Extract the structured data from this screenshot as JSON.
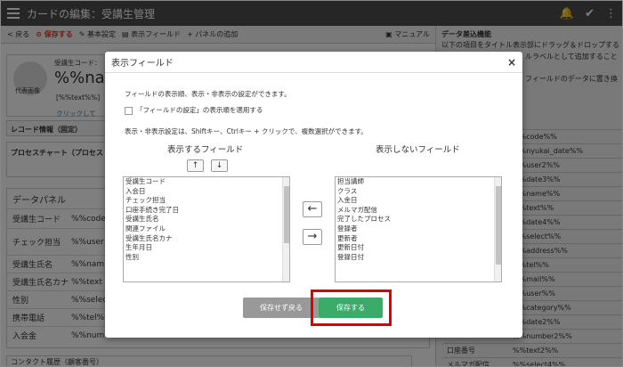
{
  "window": {
    "title": "カードの編集：受講生管理"
  },
  "toolbar": {
    "back": "< 戻る",
    "save": "保存する",
    "basic": "基本設定",
    "fields": "表示フィールド",
    "panel": "+ パネルの追加",
    "manual": "マニュアル"
  },
  "background": {
    "student_code_label": "受講生コード：",
    "name_value": "%%nam",
    "text_value": "[%%text%%]",
    "photo_label": "代表画像",
    "click_link": "クリックして",
    "record_info": "レコード情報（固定）",
    "process_chart": "プロセスチャート（プロセス",
    "data_panel": "データパネル",
    "rows": [
      {
        "label": "受講生コード",
        "value": "%%code"
      },
      {
        "label": "チェック担当",
        "value": "%%user"
      },
      {
        "label": "受講生氏名",
        "value": "%%nam"
      },
      {
        "label": "受講生氏名カナ",
        "value": "%%text"
      },
      {
        "label": "性別",
        "value": "%%select"
      },
      {
        "label": "携帯電話",
        "value": "%%tel%"
      },
      {
        "label": "入会金",
        "value": "%%num"
      }
    ],
    "history": "コンタクト履歴（顧客番号）"
  },
  "right_panel": {
    "title": "データ差込機能",
    "desc1": "以下の項目をタイトル表示部にドラッグ＆ドロップする",
    "desc2": "ルラベルとして追加すること",
    "desc3": "フィールドのデータに置き換",
    "rows": [
      {
        "k": "",
        "v": "%%code%%"
      },
      {
        "k": "",
        "v": "%%nyukai_date%%"
      },
      {
        "k": "",
        "v": "%%user2%%"
      },
      {
        "k": "",
        "v": "%%date3%%"
      },
      {
        "k": "",
        "v": "%%name%%"
      },
      {
        "k": "",
        "v": "%%text%%"
      },
      {
        "k": "",
        "v": "%%date4%%"
      },
      {
        "k": "",
        "v": "%%select%%"
      },
      {
        "k": "",
        "v": "%%address%%"
      },
      {
        "k": "",
        "v": "%%tel%%"
      },
      {
        "k": "",
        "v": "%%mail%%"
      },
      {
        "k": "",
        "v": "%%user%%"
      },
      {
        "k": "",
        "v": "%%category%%"
      },
      {
        "k": "",
        "v": "%%date2%%"
      },
      {
        "k": "",
        "v": "%%number2%%"
      },
      {
        "k": "口座番号",
        "v": "%%text2%%"
      },
      {
        "k": "メルマガ配信",
        "v": "%%select4%%"
      }
    ]
  },
  "modal": {
    "title": "表示フィールド",
    "close": "×",
    "desc": "フィールドの表示順、表示・非表示の設定ができます。",
    "checkbox_label": "「フィールドの設定」の表示順を適用する",
    "instructions": "表示・非表示設定は、Shiftキー、Ctrlキー + クリックで、複数選択ができます。",
    "shown_header": "表示するフィールド",
    "hidden_header": "表示しないフィールド",
    "up": "↑",
    "down": "↓",
    "move_left": "←",
    "move_right": "→",
    "shown_fields": [
      "受講生コード",
      "入会日",
      "チェック担当",
      "口座手続き完了日",
      "受講生氏名",
      "関連ファイル",
      "受講生氏名カナ",
      "生年月日",
      "性別"
    ],
    "hidden_fields": [
      "担当講師",
      "クラス",
      "入金日",
      "メルマガ配信",
      "完了したプロセス",
      "登録者",
      "更新者",
      "更新日付",
      "登録日付"
    ],
    "cancel": "保存せず戻る",
    "save": "保存する"
  },
  "colors": {
    "accent": "#3bab6a",
    "highlight": "#e00000",
    "topbar": "#4d4d4d"
  }
}
